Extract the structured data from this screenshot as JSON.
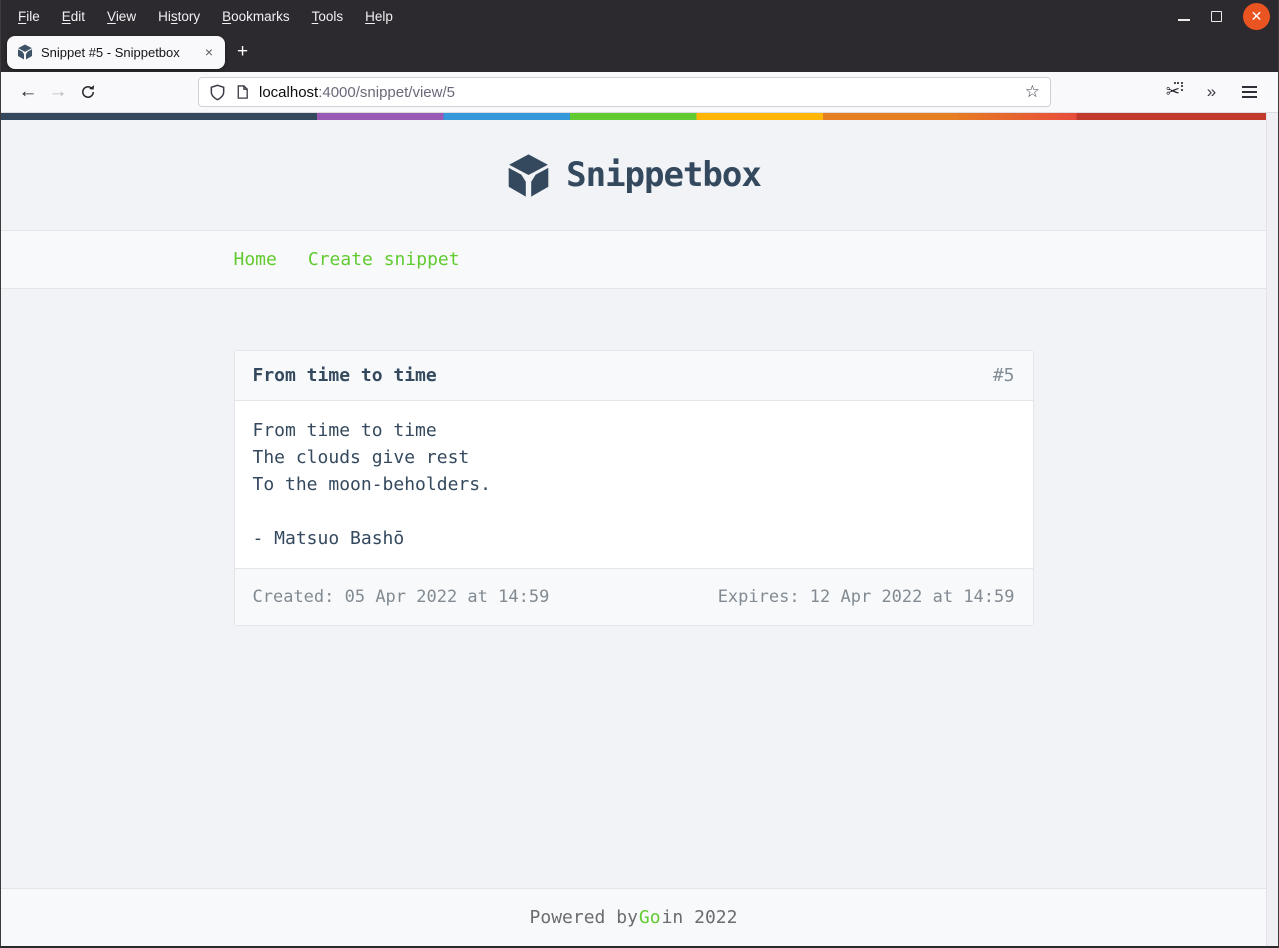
{
  "menubar": {
    "items": [
      {
        "pre": "",
        "accel": "F",
        "post": "ile"
      },
      {
        "pre": "",
        "accel": "E",
        "post": "dit"
      },
      {
        "pre": "",
        "accel": "V",
        "post": "iew"
      },
      {
        "pre": "Hi",
        "accel": "s",
        "post": "tory"
      },
      {
        "pre": "",
        "accel": "B",
        "post": "ookmarks"
      },
      {
        "pre": "",
        "accel": "T",
        "post": "ools"
      },
      {
        "pre": "",
        "accel": "H",
        "post": "elp"
      }
    ]
  },
  "tabbar": {
    "active_tab_title": "Snippet #5 - Snippetbox"
  },
  "toolbar": {
    "url": {
      "host": "localhost",
      "path": ":4000/snippet/view/5"
    }
  },
  "icons": {
    "back": "←",
    "forward": "→",
    "close_tab": "×",
    "new_tab": "+",
    "star": "☆",
    "scissors": "✂",
    "overflow_chevrons": "»",
    "window_close": "✕"
  },
  "page": {
    "header": {
      "title": "Snippetbox"
    },
    "nav": {
      "items": [
        {
          "label": "Home"
        },
        {
          "label": "Create snippet"
        }
      ]
    },
    "snippet": {
      "title": "From time to time",
      "id": "#5",
      "body": "From time to time\nThe clouds give rest\nTo the moon-beholders.\n\n- Matsuo Bashō",
      "created": "Created: 05 Apr 2022 at 14:59",
      "expires": "Expires: 12 Apr 2022 at 14:59"
    },
    "footer": {
      "prefix": "Powered by ",
      "link": "Go",
      "suffix": " in 2022"
    }
  },
  "colors": {
    "brand": "#34495E",
    "accent_green": "#62CB31",
    "page_background": "#F1F3F6",
    "strip_background": "#F7F9FA",
    "border": "#E4E5E7",
    "metadata_text": "#828A92",
    "close_button": "#E95420",
    "stripe": [
      "#34495E",
      "#9B59B6",
      "#3498DB",
      "#62CB31",
      "#FFB606",
      "#E67E22",
      "#E74C3C",
      "#C0392B"
    ]
  }
}
